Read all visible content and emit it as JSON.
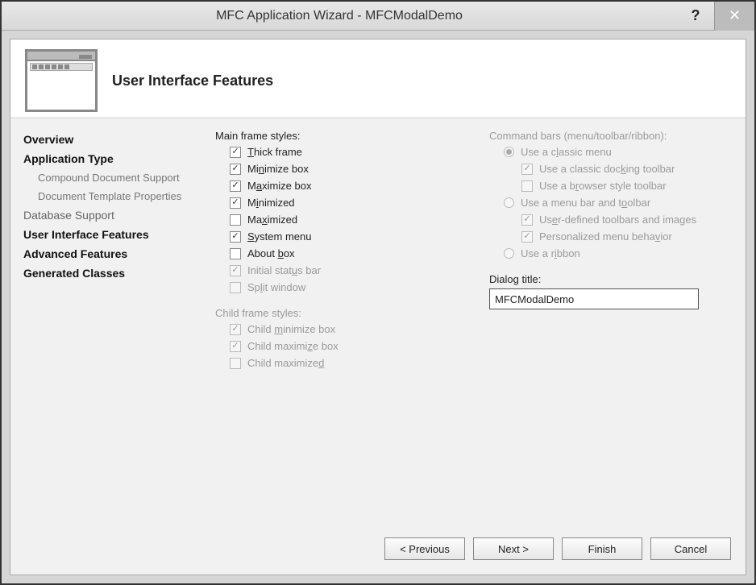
{
  "titlebar": {
    "title": "MFC Application Wizard - MFCModalDemo"
  },
  "header": {
    "title": "User Interface Features"
  },
  "sidebar": {
    "items": [
      {
        "label": "Overview",
        "bold": true,
        "child": false
      },
      {
        "label": "Application Type",
        "bold": true,
        "child": false
      },
      {
        "label": "Compound Document Support",
        "bold": false,
        "child": true
      },
      {
        "label": "Document Template Properties",
        "bold": false,
        "child": true
      },
      {
        "label": "Database Support",
        "bold": false,
        "child": false
      },
      {
        "label": "User Interface Features",
        "bold": true,
        "child": false
      },
      {
        "label": "Advanced Features",
        "bold": true,
        "child": false
      },
      {
        "label": "Generated Classes",
        "bold": true,
        "child": false
      }
    ]
  },
  "left_col": {
    "main_frame_label": "Main frame styles:",
    "main_frame": [
      {
        "label_pre": "",
        "accel": "T",
        "label_post": "hick frame",
        "checked": true,
        "enabled": true
      },
      {
        "label_pre": "Mi",
        "accel": "n",
        "label_post": "imize box",
        "checked": true,
        "enabled": true
      },
      {
        "label_pre": "M",
        "accel": "a",
        "label_post": "ximize box",
        "checked": true,
        "enabled": true
      },
      {
        "label_pre": "M",
        "accel": "i",
        "label_post": "nimized",
        "checked": true,
        "enabled": true
      },
      {
        "label_pre": "Ma",
        "accel": "x",
        "label_post": "imized",
        "checked": false,
        "enabled": true
      },
      {
        "label_pre": "",
        "accel": "S",
        "label_post": "ystem menu",
        "checked": true,
        "enabled": true
      },
      {
        "label_pre": "About ",
        "accel": "b",
        "label_post": "ox",
        "checked": false,
        "enabled": true
      },
      {
        "label_pre": "Initial stat",
        "accel": "u",
        "label_post": "s bar",
        "checked": true,
        "enabled": false
      },
      {
        "label_pre": "Sp",
        "accel": "l",
        "label_post": "it window",
        "checked": false,
        "enabled": false
      }
    ],
    "child_frame_label": "Child frame styles:",
    "child_frame": [
      {
        "label_pre": "Child ",
        "accel": "m",
        "label_post": "inimize box",
        "checked": true,
        "enabled": false
      },
      {
        "label_pre": "Child maximi",
        "accel": "z",
        "label_post": "e box",
        "checked": true,
        "enabled": false
      },
      {
        "label_pre": "Child maximize",
        "accel": "d",
        "label_post": "",
        "checked": false,
        "enabled": false
      }
    ]
  },
  "right_col": {
    "command_bars_label": "Command bars (menu/toolbar/ribbon):",
    "rows": [
      {
        "type": "radio",
        "sub": false,
        "checked": true,
        "enabled": false,
        "pre": "Use a c",
        "accel": "l",
        "post": "assic menu"
      },
      {
        "type": "check",
        "sub": true,
        "checked": true,
        "enabled": false,
        "pre": "Use a classic doc",
        "accel": "k",
        "post": "ing toolbar"
      },
      {
        "type": "check",
        "sub": true,
        "checked": false,
        "enabled": false,
        "pre": "Use a b",
        "accel": "r",
        "post": "owser style toolbar"
      },
      {
        "type": "radio",
        "sub": false,
        "checked": false,
        "enabled": false,
        "pre": "Use a menu bar and t",
        "accel": "o",
        "post": "olbar"
      },
      {
        "type": "check",
        "sub": true,
        "checked": true,
        "enabled": false,
        "pre": "Us",
        "accel": "e",
        "post": "r-defined toolbars and images"
      },
      {
        "type": "check",
        "sub": true,
        "checked": true,
        "enabled": false,
        "pre": "Personalized menu beha",
        "accel": "v",
        "post": "ior"
      },
      {
        "type": "radio",
        "sub": false,
        "checked": false,
        "enabled": false,
        "pre": "Use a r",
        "accel": "i",
        "post": "bbon"
      }
    ],
    "dialog_title_label_pre": "Dialo",
    "dialog_title_label_accel": "g",
    "dialog_title_label_post": " title:",
    "dialog_title_value": "MFCModalDemo"
  },
  "footer": {
    "previous": "< Previous",
    "next": "Next >",
    "finish": "Finish",
    "cancel": "Cancel"
  }
}
